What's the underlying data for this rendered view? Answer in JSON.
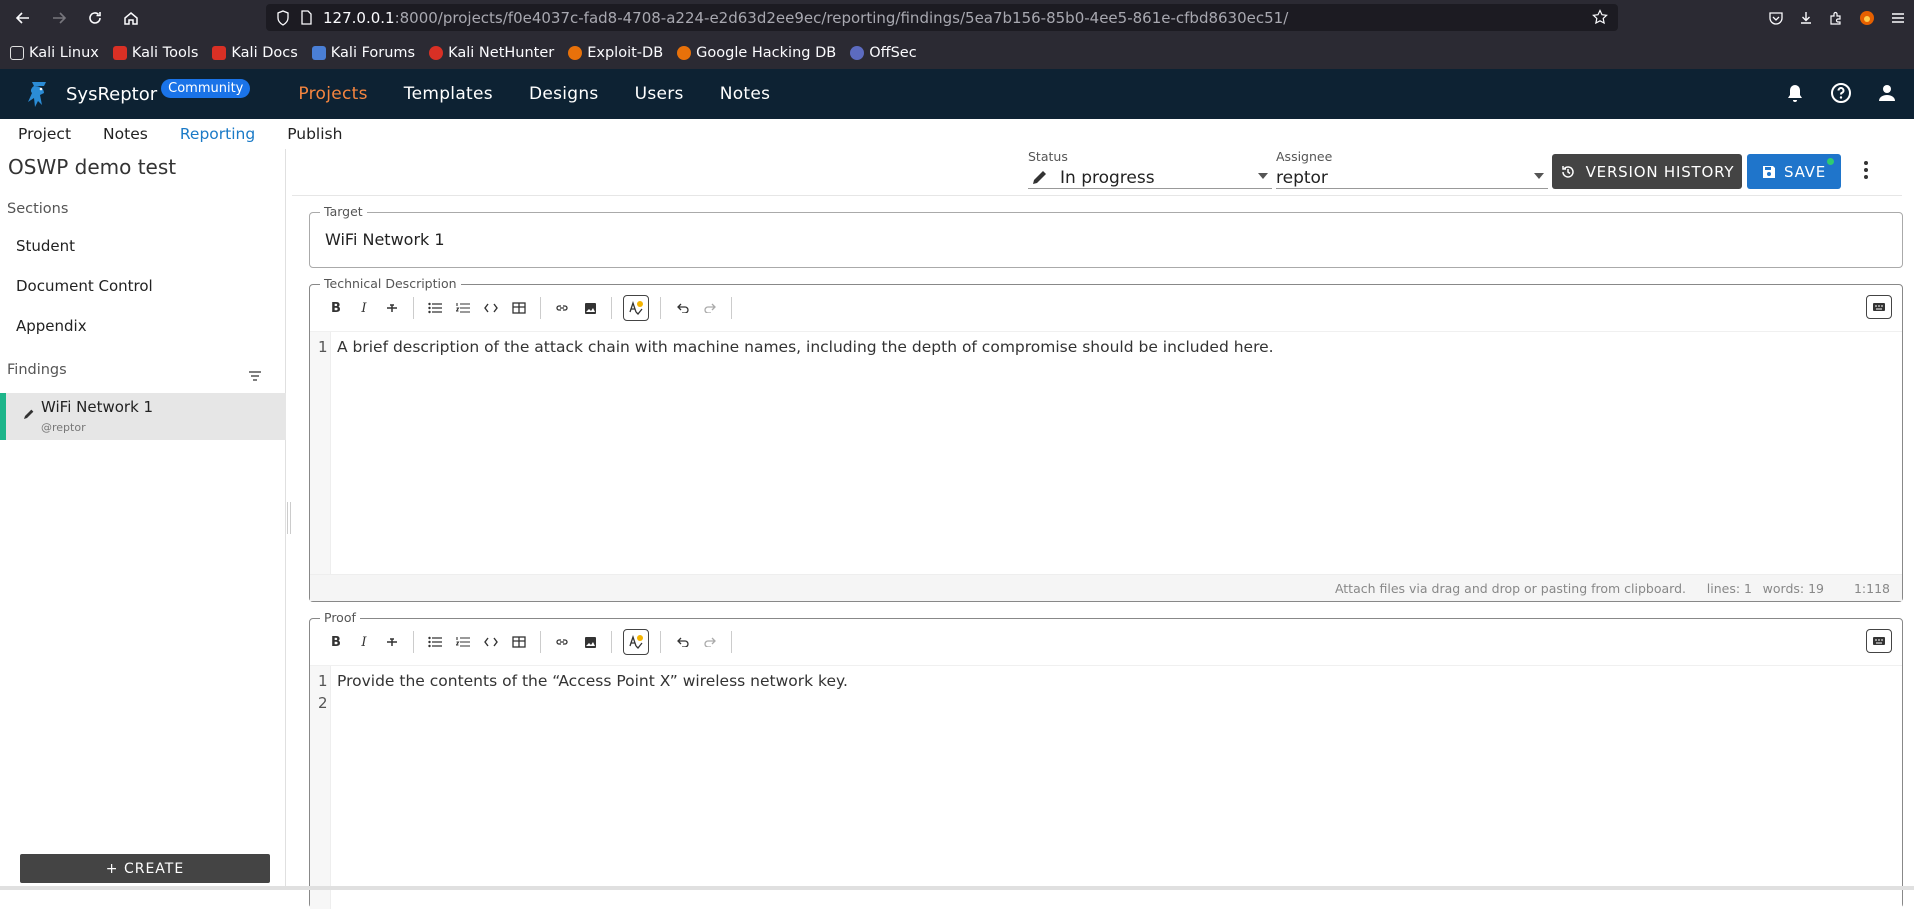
{
  "browser": {
    "url_host": "127.0.0.1",
    "url_rest": ":8000/projects/f0e4037c-fad8-4708-a224-e2d63d2ee9ec/reporting/findings/5ea7b156-85b0-4ee5-861e-cfbd8630ec51/",
    "bookmarks": [
      {
        "label": "Kali Linux",
        "color": "#e0e0e0"
      },
      {
        "label": "Kali Tools",
        "color": "#d93025"
      },
      {
        "label": "Kali Docs",
        "color": "#d93025"
      },
      {
        "label": "Kali Forums",
        "color": "#4a7fd6"
      },
      {
        "label": "Kali NetHunter",
        "color": "#d93025"
      },
      {
        "label": "Exploit-DB",
        "color": "#e8710a"
      },
      {
        "label": "Google Hacking DB",
        "color": "#e8710a"
      },
      {
        "label": "OffSec",
        "color": "#5c6bc0"
      }
    ]
  },
  "app": {
    "brand": "SysReptor",
    "edition_badge": "Community",
    "nav": [
      "Projects",
      "Templates",
      "Designs",
      "Users",
      "Notes"
    ],
    "active_nav": "Projects",
    "accent_color": "#f5853f",
    "bar_color": "#0d2233"
  },
  "subnav": {
    "items": [
      "Project",
      "Notes",
      "Reporting",
      "Publish"
    ],
    "active": "Reporting"
  },
  "sidebar": {
    "project_title": "OSWP demo test",
    "sections_label": "Sections",
    "sections": [
      "Student",
      "Document Control",
      "Appendix"
    ],
    "findings_label": "Findings",
    "findings": [
      {
        "title": "WiFi Network 1",
        "assignee": "@reptor",
        "status_color": "#1db58a"
      }
    ],
    "create_label": "+ CREATE"
  },
  "header": {
    "status_label": "Status",
    "status_value": "In progress",
    "assignee_label": "Assignee",
    "assignee_value": "reptor",
    "version_history_label": "VERSION HISTORY",
    "save_label": "SAVE"
  },
  "fields": {
    "target": {
      "label": "Target",
      "value": "WiFi Network 1"
    },
    "technical_description": {
      "label": "Technical Description",
      "lines": [
        "A brief description of the attack chain with machine names, including the depth of compromise should be included here."
      ],
      "footer": {
        "attach_hint": "Attach files via drag and drop or pasting from clipboard.",
        "lines": "lines: 1",
        "words": "words: 19",
        "position": "1:118"
      }
    },
    "proof": {
      "label": "Proof",
      "lines": [
        "Provide the contents of the “Access Point X” wireless network key.",
        ""
      ]
    }
  },
  "toolbar": {
    "bold": "B",
    "italic": "I"
  }
}
